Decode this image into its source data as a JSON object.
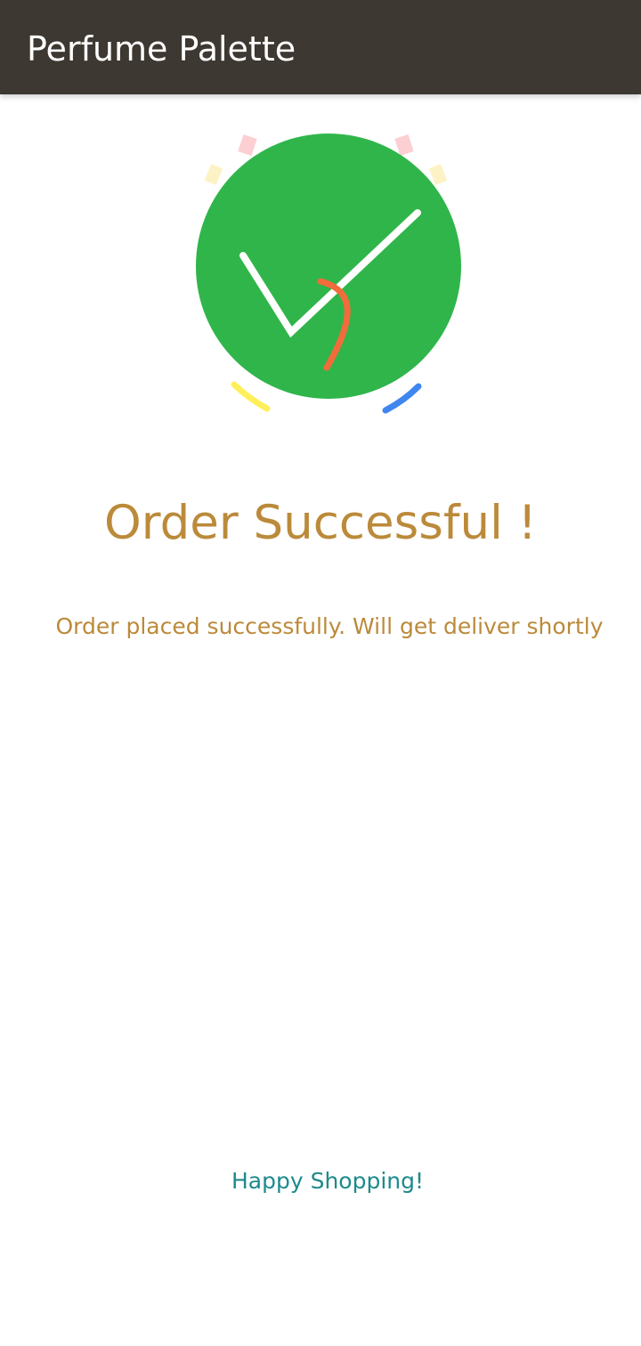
{
  "app_bar": {
    "title": "Perfume Palette",
    "background": "#3d3831"
  },
  "success_graphic": {
    "icon": "check-circle-icon",
    "circle_color": "#30b54b",
    "check_color": "#ffffff",
    "accent_stroke_color": "#f26c3b",
    "confetti_colors": [
      "#fccfd2",
      "#fdf2c5",
      "#fff05b",
      "#3f86f0"
    ]
  },
  "content": {
    "headline": "Order Successful !",
    "message": "Order placed successfully. Will get deliver shortly",
    "text_color": "#bb8a3a"
  },
  "footer": {
    "text": "Happy Shopping!",
    "text_color": "#1e8a8c"
  }
}
